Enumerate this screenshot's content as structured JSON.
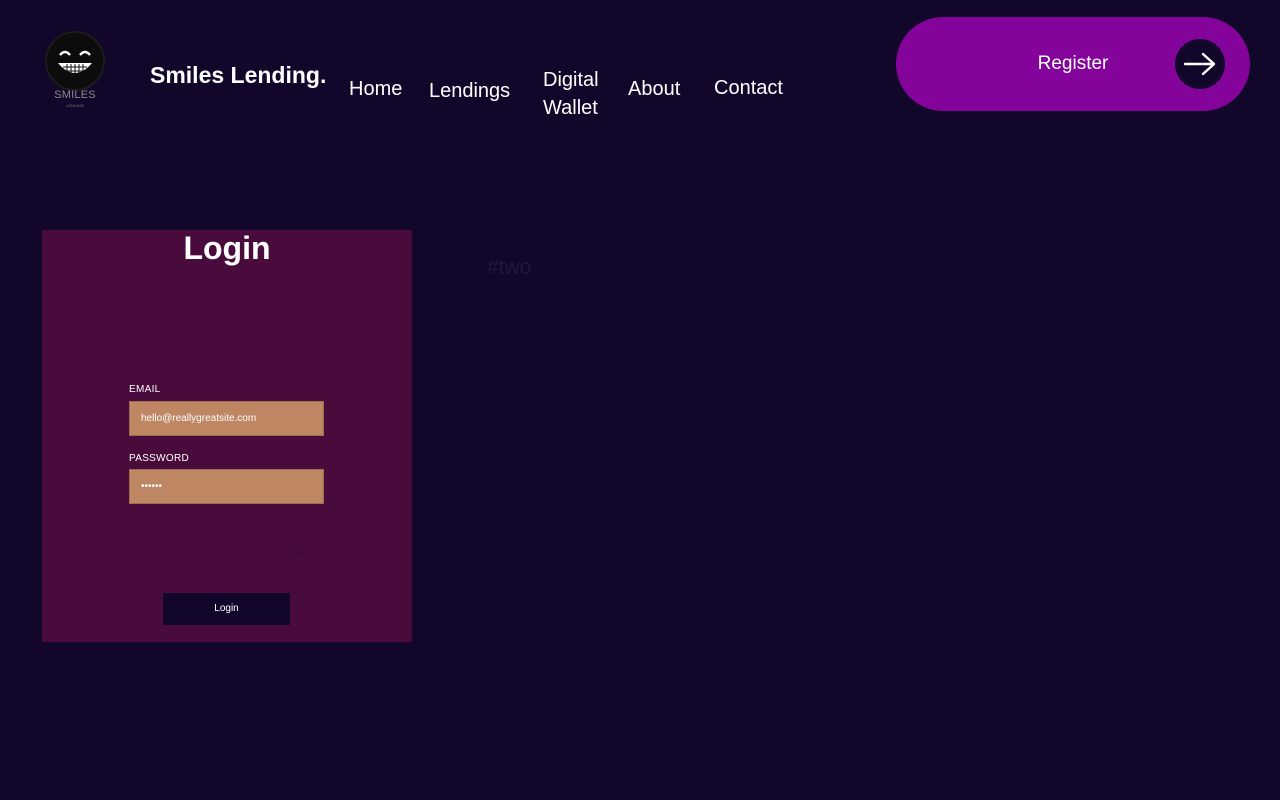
{
  "logo": {
    "text": "SMILES",
    "sub": "LENDING"
  },
  "brand": "Smiles Lending.",
  "nav": {
    "home": "Home",
    "lendings": "Lendings",
    "wallet": "Digital Wallet",
    "about": "About",
    "contact": "Contact"
  },
  "register": {
    "label": "Register",
    "icon": "arrow-right-icon"
  },
  "login": {
    "title": "Login",
    "email_label": "EMAIL",
    "email_value": "hello@reallygreatsite.com",
    "password_label": "PASSWORD",
    "password_value": "••••••",
    "submit_label": "Login"
  },
  "faint_text": "#two",
  "colors": {
    "background": "#12072a",
    "register": "#84049b",
    "card": "#480b3c",
    "input": "#be8662",
    "button": "#12072a"
  }
}
